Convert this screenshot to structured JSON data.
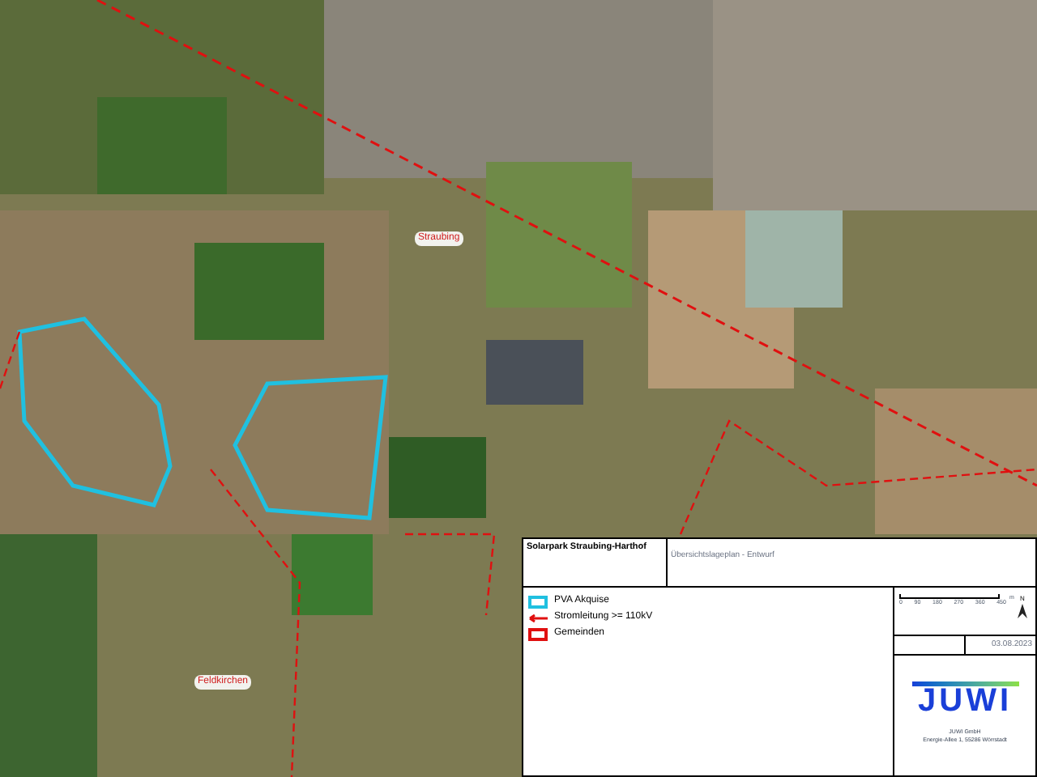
{
  "map": {
    "place_labels": [
      "Straubing",
      "Feldkirchen"
    ]
  },
  "title_block": {
    "project": "Solarpark Straubing-Harthof",
    "plan": "Übersichtslageplan - Entwurf"
  },
  "legend": [
    {
      "kind": "area",
      "label": "PVA Akquise",
      "color": "#20c0e0"
    },
    {
      "kind": "line",
      "label": "Stromleitung >= 110kV",
      "color": "#e01010"
    },
    {
      "kind": "boundary",
      "label": "Gemeinden",
      "color": "#e01010"
    }
  ],
  "scale_bar": {
    "ticks": [
      "0",
      "90",
      "180",
      "270",
      "360",
      "450"
    ],
    "unit": "m",
    "north": "N"
  },
  "date": "03.08.2023",
  "company": {
    "logo": "JUWI",
    "name": "JUWI GmbH",
    "address": "Energie-Allee 1, 55286 Wörrstadt"
  }
}
